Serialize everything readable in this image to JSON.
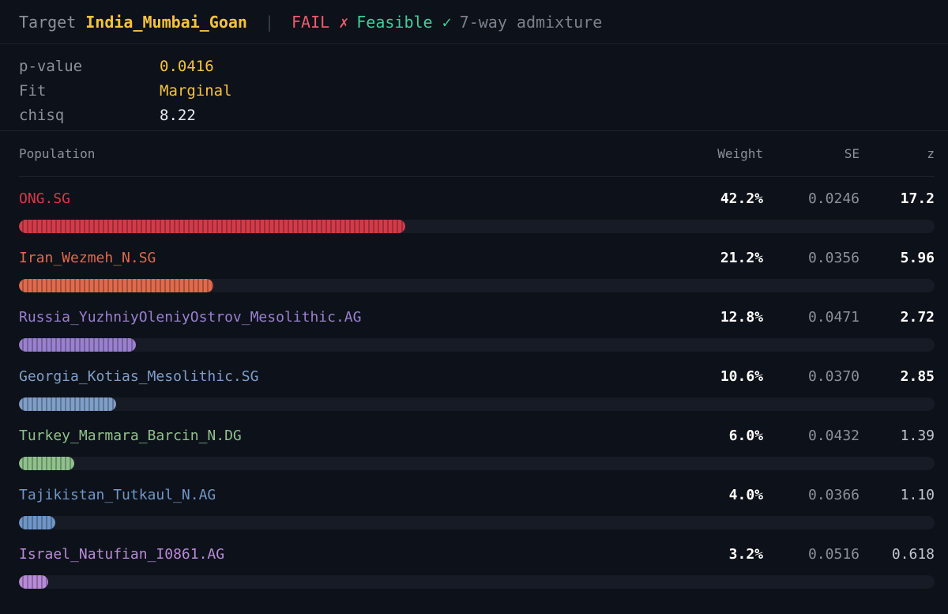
{
  "header": {
    "target_label": "Target",
    "target_name": "India_Mumbai_Goan",
    "separator": "|",
    "fail": "FAIL ✗",
    "feasible": "Feasible ✓",
    "model": "7-way admixture"
  },
  "stats": [
    {
      "key": "p-value",
      "value": "0.0416",
      "highlight": true
    },
    {
      "key": "Fit",
      "value": "Marginal",
      "highlight": true
    },
    {
      "key": "chisq",
      "value": "8.22",
      "highlight": false
    }
  ],
  "table": {
    "columns": {
      "population": "Population",
      "weight": "Weight",
      "se": "SE",
      "z": "z"
    },
    "rows": [
      {
        "population": "ONG.SG",
        "weight": "42.2%",
        "weight_fraction": 0.422,
        "se": "0.0246",
        "z": "17.2",
        "z_bold": true,
        "color": "#d33b4a"
      },
      {
        "population": "Iran_Wezmeh_N.SG",
        "weight": "21.2%",
        "weight_fraction": 0.212,
        "se": "0.0356",
        "z": "5.96",
        "z_bold": true,
        "color": "#e06a4e"
      },
      {
        "population": "Russia_YuzhniyOleniyOstrov_Mesolithic.AG",
        "weight": "12.8%",
        "weight_fraction": 0.128,
        "se": "0.0471",
        "z": "2.72",
        "z_bold": true,
        "color": "#9a80d0"
      },
      {
        "population": "Georgia_Kotias_Mesolithic.SG",
        "weight": "10.6%",
        "weight_fraction": 0.106,
        "se": "0.0370",
        "z": "2.85",
        "z_bold": true,
        "color": "#7f9ec8"
      },
      {
        "population": "Turkey_Marmara_Barcin_N.DG",
        "weight": "6.0%",
        "weight_fraction": 0.06,
        "se": "0.0432",
        "z": "1.39",
        "z_bold": false,
        "color": "#8fc18c"
      },
      {
        "population": "Tajikistan_Tutkaul_N.AG",
        "weight": "4.0%",
        "weight_fraction": 0.04,
        "se": "0.0366",
        "z": "1.10",
        "z_bold": false,
        "color": "#6f96c8"
      },
      {
        "population": "Israel_Natufian_I0861.AG",
        "weight": "3.2%",
        "weight_fraction": 0.032,
        "se": "0.0516",
        "z": "0.618",
        "z_bold": false,
        "color": "#b98ad8"
      }
    ]
  }
}
